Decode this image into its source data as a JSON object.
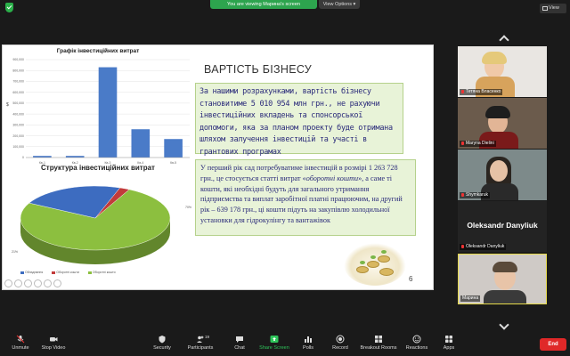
{
  "window": {
    "viewing_banner": "You are viewing Марина's screen",
    "view_options_label": "View Options ▾",
    "view_label": "View"
  },
  "slide": {
    "chart1": {
      "title": "Графік інвестиційних витрат",
      "y_ticks": [
        "900,000",
        "800,000",
        "700,000",
        "600,000",
        "500,000",
        "400,000",
        "300,000",
        "200,000",
        "100,000",
        "0"
      ],
      "ylabel": "$"
    },
    "chart2": {
      "title": "Структура інвестиційних витрат",
      "label_right": "70%",
      "label_left": "21%",
      "legend": [
        "Обладнання",
        "Оборотні кошти",
        "Оборотні кошти"
      ]
    },
    "heading": "ВАРТІСТЬ БІЗНЕСУ",
    "box1_text": "За нашими розрахунками, вартість бізнесу становитиме 5 010 954 млн грн., не рахуючи інвестиційних вкладень та спонсорської допомоги, яка за планом проекту буде отримана шляхом залучення інвестицій та участі в грантових програмах",
    "box2_text": "У перший рік сад потребуватиме інвестицій в розмірі 1 263 728 грн., це стосується статті витрат «оборотні кошти», а саме ті кошти, які необхідні будуть для загального утримання підприємства та виплат заробітної платні працюючим, на другий рік – 639 178 грн., ці кошти підуть на закупівлю холодильної установки для гідрокулінгу та вантажівок",
    "box2_italic": "оборотні кошти",
    "slide_number": "6"
  },
  "chart_data": [
    {
      "type": "bar",
      "title": "Графік інвестиційних витрат",
      "categories": [
        "Кв-1",
        "Кв-2",
        "Кв-3",
        "Кв-4",
        "Кв-5"
      ],
      "values": [
        15000,
        15000,
        830000,
        260000,
        170000
      ],
      "ylim": [
        0,
        900000
      ],
      "ylabel": "$",
      "color": "#4a7bc8",
      "grid": true
    },
    {
      "type": "pie",
      "title": "Структура інвестиційних витрат",
      "slices": [
        {
          "label": "Оборотні кошти",
          "value": 70,
          "color": "#8cbf3f"
        },
        {
          "label": "Обладнання",
          "value": 21,
          "color": "#3d6cc0"
        },
        {
          "label": "Оборотні кошти",
          "value": 2,
          "color": "#c23b3b"
        }
      ]
    }
  ],
  "participants": [
    {
      "name": "Тетяна Власенко",
      "muted": true
    },
    {
      "name": "Maryna Dielini",
      "muted": true
    },
    {
      "name": "Shymkaruk",
      "muted": true
    },
    {
      "name": "Oleksandr Danyliuk",
      "muted": true,
      "big_name": "Oleksandr Danyliuk"
    },
    {
      "name": "Марина",
      "muted": false
    }
  ],
  "toolbar": {
    "unmute": "Unmute",
    "stop_video": "Stop Video",
    "security": "Security",
    "participants": "Participants",
    "participants_count": "19",
    "chat": "Chat",
    "share_screen": "Share Screen",
    "polls": "Polls",
    "record": "Record",
    "breakout_rooms": "Breakout Rooms",
    "reactions": "Reactions",
    "apps": "Apps",
    "end": "End"
  },
  "colors": {
    "accent_green": "#2da44e",
    "end_red": "#e02828",
    "box_bg": "#e8f3d8",
    "bar_blue": "#4a7bc8"
  }
}
